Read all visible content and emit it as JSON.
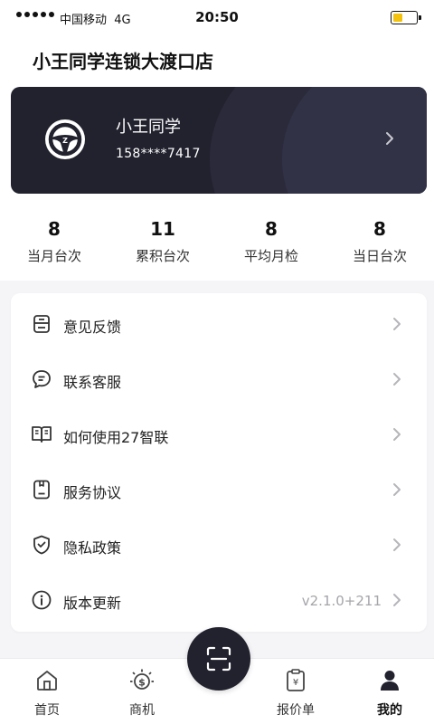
{
  "status_bar": {
    "carrier": "中国移动",
    "network": "4G",
    "time": "20:50"
  },
  "header": {
    "store_name": "小王同学连锁大渡口店"
  },
  "profile": {
    "name": "小王同学",
    "phone": "158****7417"
  },
  "stats": [
    {
      "value": "8",
      "label": "当月台次"
    },
    {
      "value": "11",
      "label": "累积台次"
    },
    {
      "value": "8",
      "label": "平均月检"
    },
    {
      "value": "8",
      "label": "当日台次"
    }
  ],
  "menu": [
    {
      "icon": "inbox-icon",
      "label": "意见反馈",
      "extra": ""
    },
    {
      "icon": "chat-icon",
      "label": "联系客服",
      "extra": ""
    },
    {
      "icon": "book-icon",
      "label": "如何使用27智联",
      "extra": ""
    },
    {
      "icon": "document-icon",
      "label": "服务协议",
      "extra": ""
    },
    {
      "icon": "shield-icon",
      "label": "隐私政策",
      "extra": ""
    },
    {
      "icon": "info-icon",
      "label": "版本更新",
      "extra": "v2.1.0+211"
    }
  ],
  "tabs": [
    {
      "icon": "home-icon",
      "label": "首页"
    },
    {
      "icon": "business-icon",
      "label": "商机"
    },
    {
      "icon": "scan-icon",
      "label": ""
    },
    {
      "icon": "quote-icon",
      "label": "报价单"
    },
    {
      "icon": "user-icon",
      "label": "我的",
      "active": true
    }
  ],
  "colors": {
    "card_bg": "#22222f",
    "accent": "#22222f",
    "battery": "#f3c20d",
    "muted": "#a5a5aa"
  }
}
